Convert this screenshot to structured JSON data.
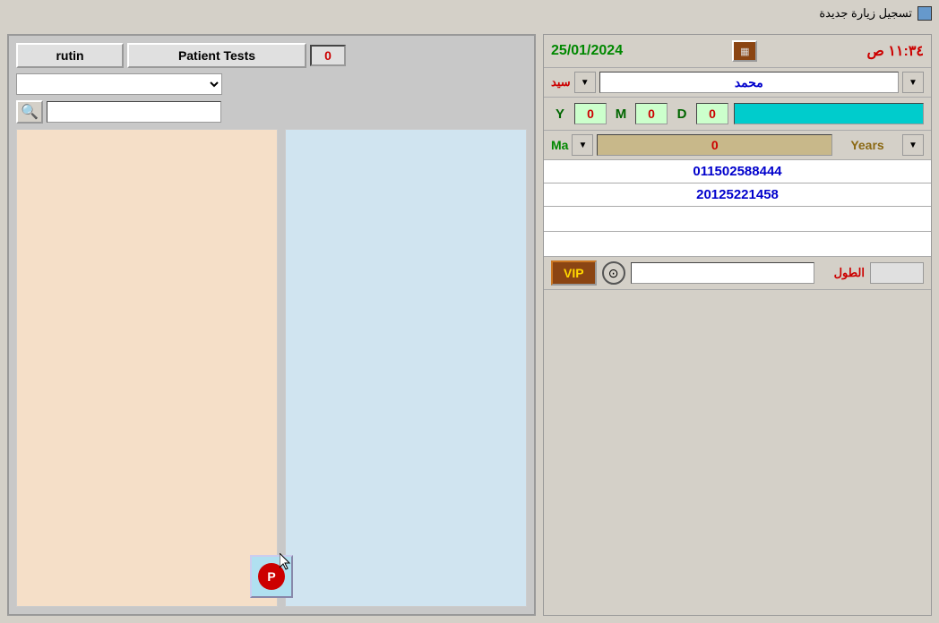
{
  "titleBar": {
    "icon": "grid-icon",
    "text": "تسجيل زيارة جديدة"
  },
  "leftPanel": {
    "rutinLabel": "rutin",
    "patientTestsLabel": "Patient Tests",
    "badgeValue": "0",
    "dropdownOptions": [],
    "searchPlaceholder": ""
  },
  "rightPanel": {
    "date": "25/01/2024",
    "time": "١١:٣٤ ص",
    "calendarIcon": "calendar-icon",
    "nameLabel": "سید",
    "nameValue": "محمد",
    "ymd": {
      "yLabel": "Y",
      "yValue": "0",
      "mLabel": "M",
      "mValue": "0",
      "dLabel": "D",
      "dValue": "0"
    },
    "yearsLabel": "Years",
    "yearsValue": "0",
    "maLabel": "Ma",
    "phone1": "011502588444",
    "phone2": "20125221458",
    "vipLabel": "VIP",
    "heightLabel": "الطول"
  },
  "printBtn": {
    "label": "P"
  },
  "icons": {
    "search": "🔍",
    "chevronDown": "▼",
    "target": "◎",
    "calendar": "📅"
  }
}
